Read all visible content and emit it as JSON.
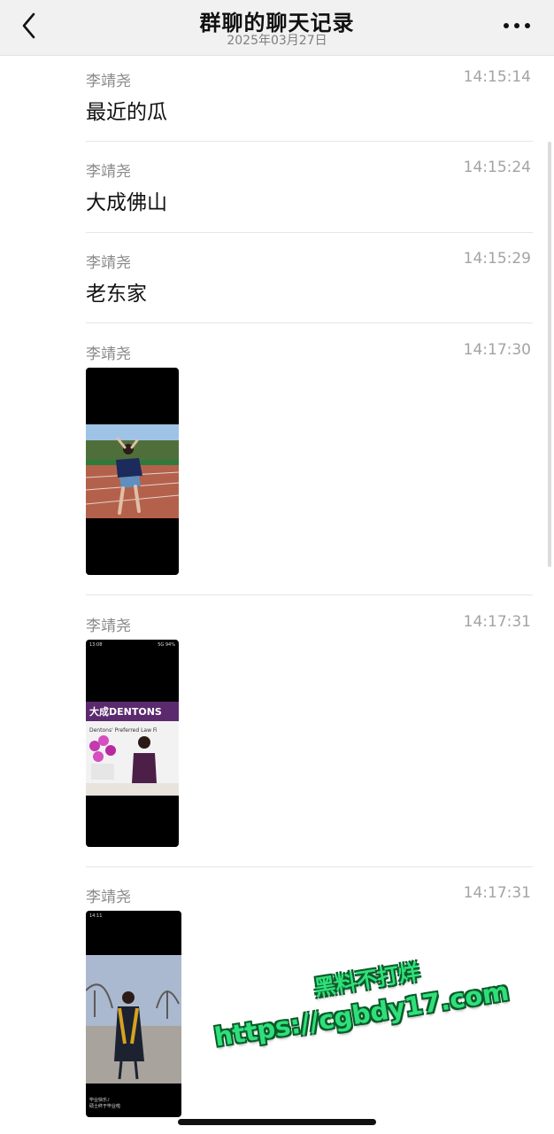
{
  "header": {
    "title": "群聊的聊天记录",
    "date": "2025年03月27日",
    "back_icon": "chevron-left-icon",
    "more_icon": "more-dots-icon"
  },
  "messages": [
    {
      "sender": "李靖尧",
      "time": "14:15:14",
      "text": "最近的瓜"
    },
    {
      "sender": "李靖尧",
      "time": "14:15:24",
      "text": "大成佛山"
    },
    {
      "sender": "李靖尧",
      "time": "14:15:29",
      "text": "老东家"
    },
    {
      "sender": "李靖尧",
      "time": "14:17:30",
      "image": "photo of a woman posing on a running track"
    },
    {
      "sender": "李靖尧",
      "time": "14:17:31",
      "image": "screenshot of a woman in front of a 大成 DENTONS sign",
      "image_text": {
        "status_time": "13:08",
        "status_right": "5G 94%",
        "sign_brand": "大成DENTONS",
        "sign_sub": "Dentons' Preferred Law Fi"
      }
    },
    {
      "sender": "李靖尧",
      "time": "14:17:31",
      "image": "screenshot of a woman in a graduation gown outdoors",
      "image_text": {
        "status_time": "14:11",
        "caption_1": "毕业快乐♪",
        "caption_2": "硕士终于毕业啦"
      }
    }
  ],
  "watermark": {
    "line1": "黑料不打烊",
    "line2": "https://cgbdy17.com"
  }
}
